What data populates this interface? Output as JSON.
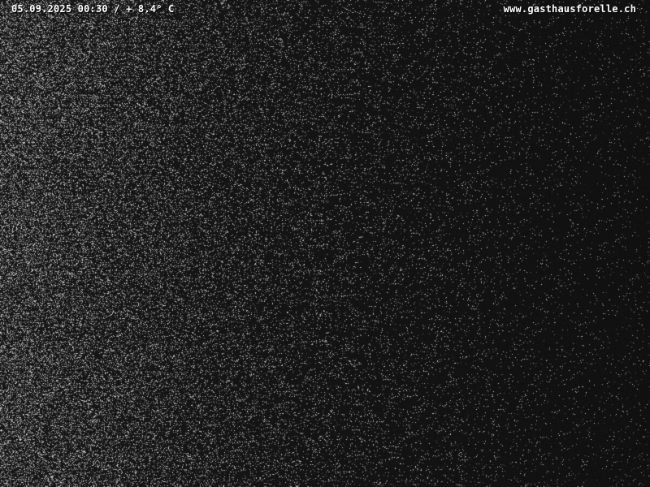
{
  "overlay": {
    "timestamp": "05.09.2025 00:30 / + 8.4° C",
    "site_url": "www.gasthausforelle.ch"
  },
  "colors": {
    "background": "#121212",
    "noise": "#d8d8d8",
    "text": "#ffffff"
  }
}
